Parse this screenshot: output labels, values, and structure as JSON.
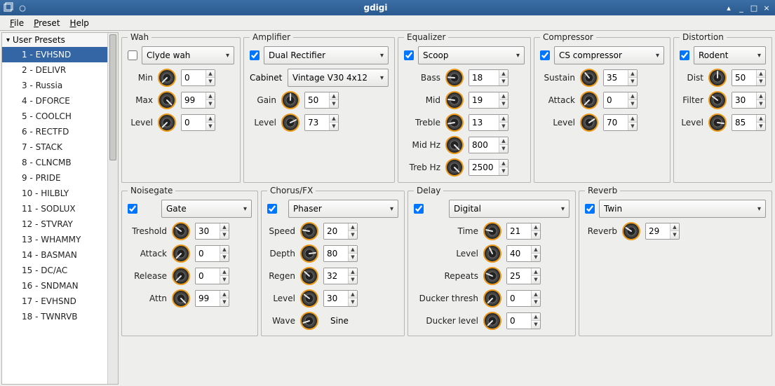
{
  "window": {
    "title": "gdigi"
  },
  "menubar": {
    "file": "File",
    "preset": "Preset",
    "help": "Help"
  },
  "sidebar": {
    "header": "User Presets",
    "items": [
      "1 - EVHSND",
      "2 - DELIVR",
      "3 - Russia",
      "4 - DFORCE",
      "5 - COOLCH",
      "6 - RECTFD",
      "7 - STACK",
      "8 - CLNCMB",
      "9 - PRIDE",
      "10 - HILBLY",
      "11 - SODLUX",
      "12 - STVRAY",
      "13 - WHAMMY",
      "14 - BASMAN",
      "15 - DC/AC",
      "16 - SNDMAN",
      "17 - EVHSND",
      "18 - TWNRVB"
    ],
    "selected_index": 0
  },
  "panels": {
    "wah": {
      "title": "Wah",
      "enabled": false,
      "type": "Clyde wah",
      "params": [
        {
          "label": "Min",
          "value": 0
        },
        {
          "label": "Max",
          "value": 99
        },
        {
          "label": "Level",
          "value": 0
        }
      ]
    },
    "amplifier": {
      "title": "Amplifier",
      "enabled": true,
      "type": "Dual Rectifier",
      "cabinet_label": "Cabinet",
      "cabinet": "Vintage V30 4x12",
      "params": [
        {
          "label": "Gain",
          "value": 50
        },
        {
          "label": "Level",
          "value": 73
        }
      ]
    },
    "equalizer": {
      "title": "Equalizer",
      "enabled": true,
      "type": "Scoop",
      "params": [
        {
          "label": "Bass",
          "value": 18
        },
        {
          "label": "Mid",
          "value": 19
        },
        {
          "label": "Treble",
          "value": 13
        },
        {
          "label": "Mid Hz",
          "value": 800
        },
        {
          "label": "Treb Hz",
          "value": 2500
        }
      ]
    },
    "compressor": {
      "title": "Compressor",
      "enabled": true,
      "type": "CS compressor",
      "params": [
        {
          "label": "Sustain",
          "value": 35
        },
        {
          "label": "Attack",
          "value": 0
        },
        {
          "label": "Level",
          "value": 70
        }
      ]
    },
    "distortion": {
      "title": "Distortion",
      "enabled": true,
      "type": "Rodent",
      "params": [
        {
          "label": "Dist",
          "value": 50
        },
        {
          "label": "Filter",
          "value": 30
        },
        {
          "label": "Level",
          "value": 85
        }
      ]
    },
    "noisegate": {
      "title": "Noisegate",
      "enabled": true,
      "type": "Gate",
      "params": [
        {
          "label": "Treshold",
          "value": 30
        },
        {
          "label": "Attack",
          "value": 0
        },
        {
          "label": "Release",
          "value": 0
        },
        {
          "label": "Attn",
          "value": 99
        }
      ]
    },
    "chorusfx": {
      "title": "Chorus/FX",
      "enabled": true,
      "type": "Phaser",
      "params": [
        {
          "label": "Speed",
          "value": 20
        },
        {
          "label": "Depth",
          "value": 80
        },
        {
          "label": "Regen",
          "value": 32
        },
        {
          "label": "Level",
          "value": 30
        }
      ],
      "wave_label": "Wave",
      "wave": "Sine"
    },
    "delay": {
      "title": "Delay",
      "enabled": true,
      "type": "Digital",
      "params": [
        {
          "label": "Time",
          "value": 21
        },
        {
          "label": "Level",
          "value": 40
        },
        {
          "label": "Repeats",
          "value": 25
        },
        {
          "label": "Ducker thresh",
          "value": 0
        },
        {
          "label": "Ducker level",
          "value": 0
        }
      ]
    },
    "reverb": {
      "title": "Reverb",
      "enabled": true,
      "type": "Twin",
      "params": [
        {
          "label": "Reverb",
          "value": 29
        }
      ]
    }
  }
}
